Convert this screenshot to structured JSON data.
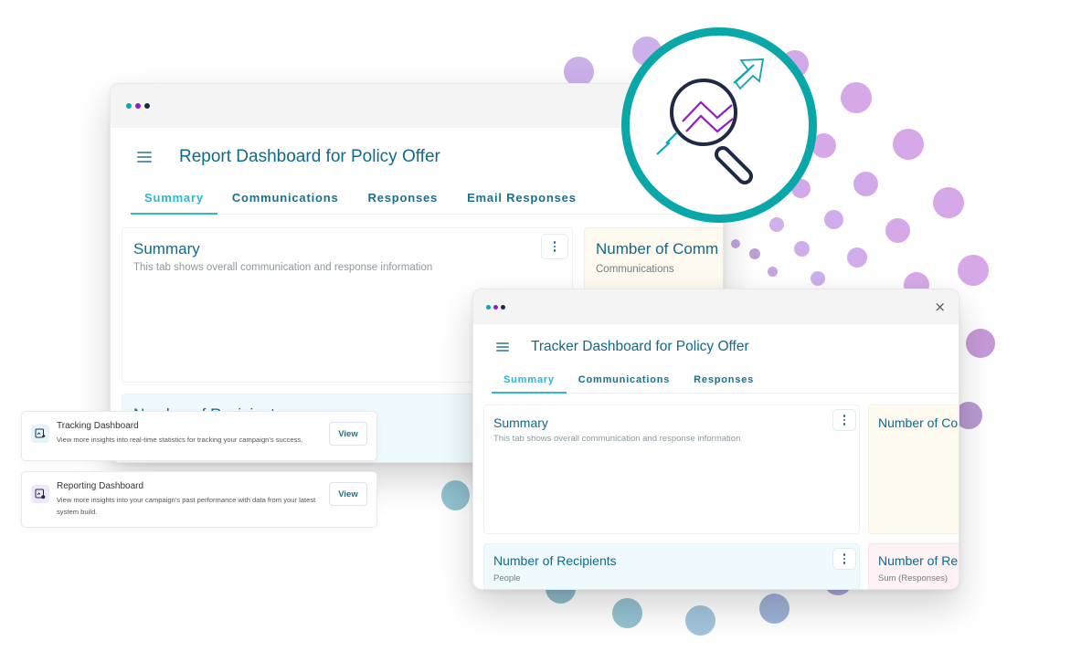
{
  "colors": {
    "brand_teal": "#0aa7b0",
    "brand_purple": "#8d1ec7",
    "brand_navy": "#1e2a44",
    "title_text": "#0e6b8a",
    "tab_active": "#2fb5d5",
    "dot_purple": "#cfa8e8",
    "dot_blue": "#8fbfd0"
  },
  "report_window": {
    "title": "Report Dashboard for Policy Offer",
    "tabs": [
      {
        "label": "Summary",
        "active": true
      },
      {
        "label": "Communications",
        "active": false
      },
      {
        "label": "Responses",
        "active": false
      },
      {
        "label": "Email Responses",
        "active": false
      }
    ],
    "cards": {
      "summary": {
        "title": "Summary",
        "subtitle": "This tab shows overall communication and response information"
      },
      "communications": {
        "title": "Number of Comm",
        "subtitle": "Communications"
      },
      "recipients": {
        "title": "Number of Recipients"
      }
    }
  },
  "tracker_window": {
    "title": "Tracker Dashboard for Policy Offer",
    "close_icon": "close-icon",
    "tabs": [
      {
        "label": "Summary",
        "active": true
      },
      {
        "label": "Communications",
        "active": false
      },
      {
        "label": "Responses",
        "active": false
      }
    ],
    "cards": {
      "summary": {
        "title": "Summary",
        "subtitle": "This tab shows overall communication and response information"
      },
      "communications": {
        "title": "Number of Co"
      },
      "recipients": {
        "title": "Number of Recipients",
        "subtitle": "People"
      },
      "responses": {
        "title": "Number of Re",
        "subtitle": "Sum (Responses)"
      }
    }
  },
  "dashboard_links": [
    {
      "title": "Tracking Dashboard",
      "description": "View more insights into real-time statistics for tracking your campaign's success.",
      "button": "View",
      "icon": "tracking-chart-icon"
    },
    {
      "title": "Reporting Dashboard",
      "description": "View more insights into your campaign's past performance with data from your latest system build.",
      "button": "View",
      "icon": "reporting-chart-icon"
    }
  ],
  "hero_icon": "magnifier-trend-icon"
}
